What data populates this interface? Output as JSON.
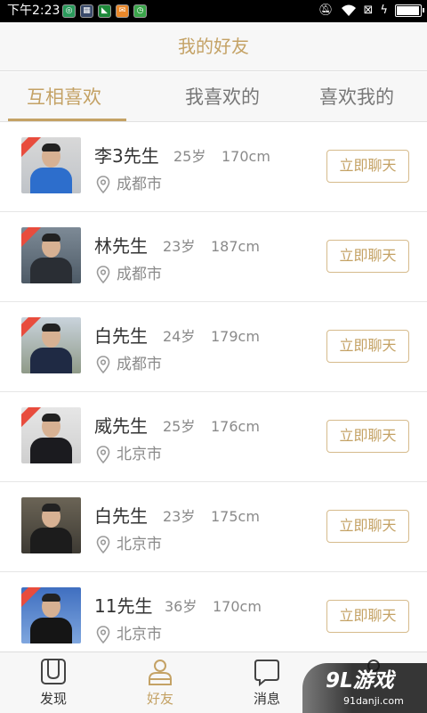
{
  "status_bar": {
    "time": "下午2:23",
    "apps": [
      "app-icon-1",
      "app-icon-2",
      "app-icon-3",
      "app-icon-4",
      "app-icon-5"
    ],
    "icons": [
      "mute-icon",
      "wifi-icon",
      "no-sim-icon",
      "charging-icon",
      "battery-icon"
    ],
    "battery_level": 0.9
  },
  "header": {
    "title": "我的好友"
  },
  "tabs": [
    {
      "label": "互相喜欢",
      "active": true
    },
    {
      "label": "我喜欢的",
      "active": false
    },
    {
      "label": "喜欢我的",
      "active": false
    }
  ],
  "friends": [
    {
      "name": "李3先生",
      "age": "25岁",
      "height": "170cm",
      "city": "成都市",
      "button": "立即聊天"
    },
    {
      "name": "林先生",
      "age": "23岁",
      "height": "187cm",
      "city": "成都市",
      "button": "立即聊天"
    },
    {
      "name": "白先生",
      "age": "24岁",
      "height": "179cm",
      "city": "成都市",
      "button": "立即聊天"
    },
    {
      "name": "威先生",
      "age": "25岁",
      "height": "176cm",
      "city": "北京市",
      "button": "立即聊天"
    },
    {
      "name": "白先生",
      "age": "23岁",
      "height": "175cm",
      "city": "北京市",
      "button": "立即聊天"
    },
    {
      "name": "11先生",
      "age": "36岁",
      "height": "170cm",
      "city": "北京市",
      "button": "立即聊天"
    }
  ],
  "bottom_nav": [
    {
      "label": "发现",
      "icon": "discover-icon",
      "active": false
    },
    {
      "label": "好友",
      "icon": "friends-icon",
      "active": true
    },
    {
      "label": "消息",
      "icon": "message-icon",
      "active": false
    },
    {
      "label": "",
      "icon": "profile-icon",
      "active": false
    }
  ],
  "watermark": {
    "logo": "9L游戏",
    "site": "91danji.com"
  },
  "colors": {
    "accent": "#c4a265",
    "ribbon": "#e84c3d",
    "text": "#333333",
    "muted": "#8a8a8a"
  }
}
